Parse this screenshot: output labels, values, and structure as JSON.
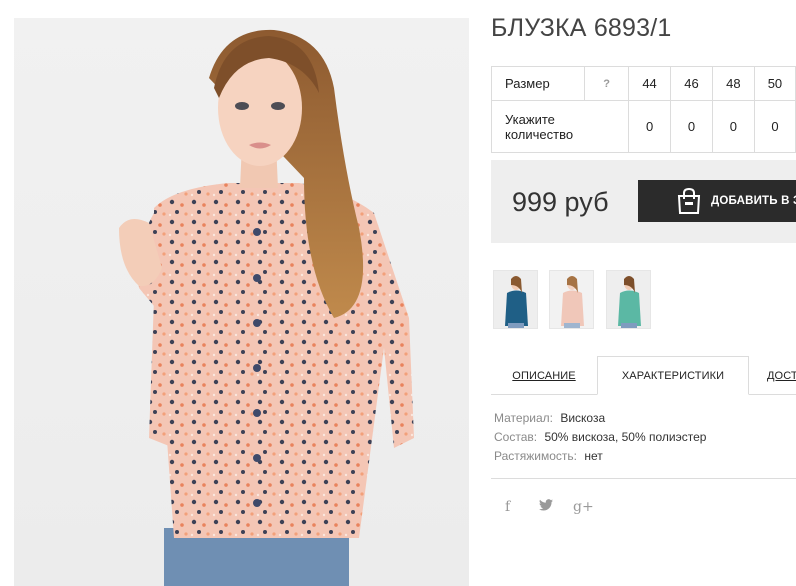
{
  "product": {
    "title": "БЛУЗКА 6893/1",
    "image_alt": "main product photo - woman in peach blouse with print"
  },
  "size_table": {
    "size_label": "Размер",
    "help_mark": "?",
    "sizes": [
      "44",
      "46",
      "48",
      "50"
    ],
    "quantity_label": "Укажите количество",
    "quantities": [
      "0",
      "0",
      "0",
      "0"
    ]
  },
  "purchase": {
    "price": "999 руб",
    "add_to_cart_label": "ДОБАВИТЬ В ЗА"
  },
  "thumbnails": [
    {
      "name": "blue-blouse",
      "color": "#1f5f86"
    },
    {
      "name": "peach-blouse",
      "color": "#f0c7b9"
    },
    {
      "name": "mint-blouse",
      "color": "#5bb8a4"
    }
  ],
  "tabs": [
    {
      "label": "ОПИСАНИЕ"
    },
    {
      "label": "ХАРАКТЕРИСТИКИ"
    },
    {
      "label": "ДОСТ"
    }
  ],
  "specs": [
    {
      "key": "Материал:",
      "value": "Вискоза"
    },
    {
      "key": "Состав:",
      "value": "50% вискоза, 50% полиэстер"
    },
    {
      "key": "Растяжимость:",
      "value": "нет"
    }
  ],
  "social": {
    "facebook": "f",
    "twitter": "🐦",
    "googleplus": "g+"
  },
  "colors": {
    "button_bg": "#2b2b2b",
    "price_box_bg": "#eeeeee",
    "border": "#dcdcdc"
  }
}
